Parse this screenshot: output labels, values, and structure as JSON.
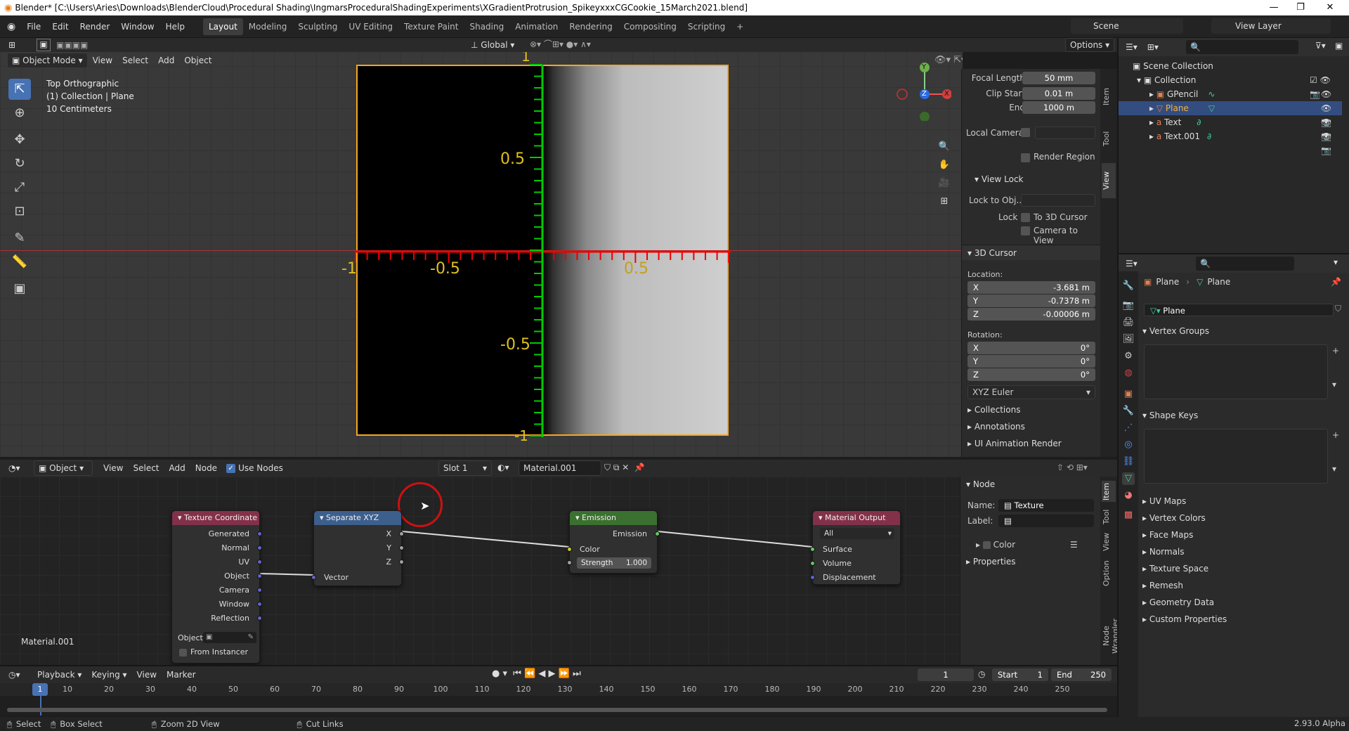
{
  "window": {
    "title": "Blender* [C:\\Users\\Aries\\Downloads\\BlenderCloud\\Procedural Shading\\IngmarsProceduralShadingExperiments\\XGradientProtrusion_SpikeyxxxCGCookie_15March2021.blend]",
    "min": "—",
    "max": "❐",
    "close": "✕"
  },
  "menu": [
    "File",
    "Edit",
    "Render",
    "Window",
    "Help"
  ],
  "workspaces": [
    "Layout",
    "Modeling",
    "Sculpting",
    "UV Editing",
    "Texture Paint",
    "Shading",
    "Animation",
    "Rendering",
    "Compositing",
    "Scripting"
  ],
  "workspace_add": "+",
  "scene": "Scene",
  "view_layer": "View Layer",
  "viewport_header": {
    "mode": "Object Mode",
    "menus": [
      "View",
      "Select",
      "Add",
      "Object"
    ],
    "orientation": "Global",
    "options": "Options"
  },
  "viewport_info": [
    "Top Orthographic",
    "(1) Collection | Plane",
    "10 Centimeters"
  ],
  "ruler": {
    "x_labels": [
      "-1",
      "-0.5",
      "0.5"
    ],
    "y_labels": [
      "0.5",
      "-0.5",
      "1",
      "-1"
    ]
  },
  "gizmo": {
    "y": "Y",
    "z": "Z",
    "x": "X"
  },
  "npanel": {
    "tabs": [
      "Item",
      "Tool",
      "View"
    ],
    "focal_length_label": "Focal Length",
    "focal_length": "50 mm",
    "clip_start_label": "Clip Start",
    "clip_start": "0.01 m",
    "clip_end_label": "End",
    "clip_end": "1000 m",
    "local_camera": "Local Camera",
    "render_region": "Render Region",
    "view_lock": "View Lock",
    "lock_to_obj": "Lock to Obj...",
    "lock": "Lock",
    "to_3d_cursor": "To 3D Cursor",
    "camera_to_view": "Camera to View",
    "cursor_header": "3D Cursor",
    "location": "Location:",
    "loc": [
      {
        "axis": "X",
        "val": "-3.681 m"
      },
      {
        "axis": "Y",
        "val": "-0.7378 m"
      },
      {
        "axis": "Z",
        "val": "-0.00006 m"
      }
    ],
    "rotation": "Rotation:",
    "rot": [
      {
        "axis": "X",
        "val": "0°"
      },
      {
        "axis": "Y",
        "val": "0°"
      },
      {
        "axis": "Z",
        "val": "0°"
      }
    ],
    "euler": "XYZ Euler",
    "sections": [
      "Collections",
      "Annotations",
      "UI Animation Render"
    ]
  },
  "node_header": {
    "type": "Object",
    "menus": [
      "View",
      "Select",
      "Add",
      "Node"
    ],
    "use_nodes": "Use Nodes",
    "slot": "Slot 1",
    "material": "Material.001"
  },
  "nodes": {
    "texcoord": {
      "title": "Texture Coordinate",
      "outs": [
        "Generated",
        "Normal",
        "UV",
        "Object",
        "Camera",
        "Window",
        "Reflection"
      ],
      "object": "Object:",
      "from_instancer": "From Instancer"
    },
    "sepxyz": {
      "title": "Separate XYZ",
      "outs": [
        "X",
        "Y",
        "Z"
      ],
      "in": "Vector"
    },
    "emission": {
      "title": "Emission",
      "out": "Emission",
      "color": "Color",
      "strength_label": "Strength",
      "strength": "1.000"
    },
    "output": {
      "title": "Material Output",
      "target": "All",
      "ins": [
        "Surface",
        "Volume",
        "Displacement"
      ]
    }
  },
  "node_material_label": "Material.001",
  "node_npanel": {
    "tabs": [
      "Item",
      "Tool",
      "View",
      "Option",
      "Node Wrangler"
    ],
    "node": "Node",
    "name_label": "Name:",
    "name": "Texture Coordinate",
    "label_label": "Label:",
    "color": "Color",
    "properties": "Properties"
  },
  "outliner": {
    "root": "Scene Collection",
    "collection": "Collection",
    "items": [
      {
        "name": "GPencil"
      },
      {
        "name": "Plane"
      },
      {
        "name": "Text"
      },
      {
        "name": "Text.001"
      }
    ]
  },
  "properties": {
    "crumb1": "Plane",
    "crumb2": "Plane",
    "mesh": "Plane",
    "vertex_groups": "Vertex Groups",
    "shape_keys": "Shape Keys",
    "sections": [
      "UV Maps",
      "Vertex Colors",
      "Face Maps",
      "Normals",
      "Texture Space",
      "Remesh",
      "Geometry Data",
      "Custom Properties"
    ]
  },
  "timeline": {
    "menus": [
      "Playback",
      "Keying",
      "View",
      "Marker"
    ],
    "current": "1",
    "start_label": "Start",
    "start": "1",
    "end_label": "End",
    "end": "250",
    "ticks": [
      "1",
      "10",
      "20",
      "30",
      "40",
      "50",
      "60",
      "70",
      "80",
      "90",
      "100",
      "110",
      "120",
      "130",
      "140",
      "150",
      "160",
      "170",
      "180",
      "190",
      "200",
      "210",
      "220",
      "230",
      "240",
      "250"
    ]
  },
  "statusbar": {
    "select": "Select",
    "box_select": "Box Select",
    "zoom": "Zoom 2D View",
    "cut": "Cut Links",
    "version": "2.93.0 Alpha"
  },
  "colors": {
    "accent": "#4772b3",
    "texcoord": "#83314a",
    "sepxyz": "#3c5f8c",
    "emission": "#3b7030",
    "output": "#83314a",
    "socket_vec": "#6363c7",
    "socket_float": "#a1a1a1",
    "socket_col": "#c7c729",
    "socket_shader": "#63c763"
  }
}
